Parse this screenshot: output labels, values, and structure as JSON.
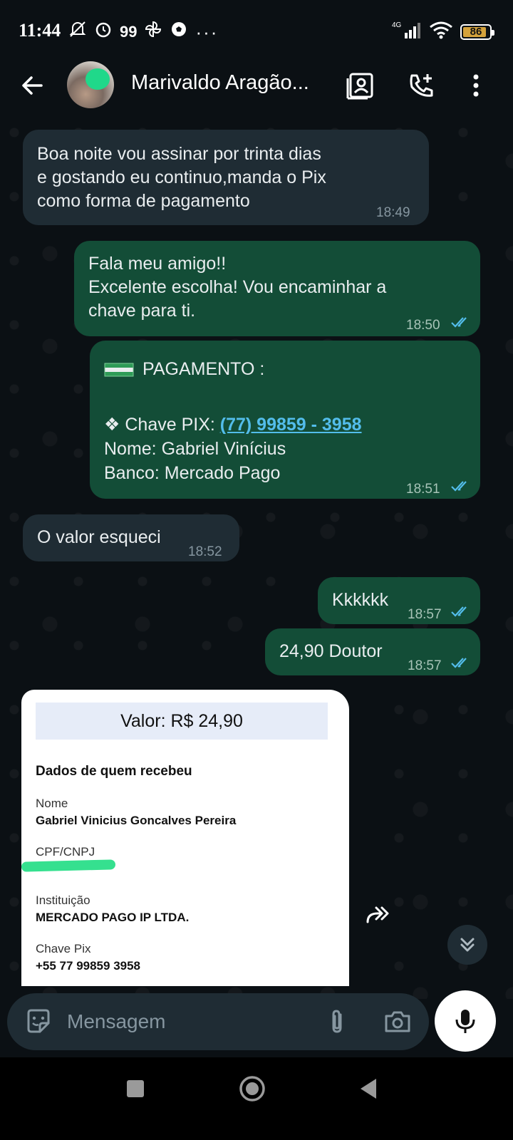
{
  "status": {
    "time": "11:44",
    "left_icons": [
      "mute-icon",
      "alarm-icon",
      "app-99-icon",
      "pinwheel-icon",
      "soccer-icon",
      "more-dots-icon"
    ],
    "app_99": "99",
    "dots": "···",
    "network": "4G",
    "battery": "86"
  },
  "header": {
    "contact_name": "Marivaldo Aragão..."
  },
  "messages": [
    {
      "dir": "in",
      "text": "Boa noite vou assinar por trinta dias\ne gostando eu continuo,manda o Pix\ncomo forma de pagamento",
      "time": "18:49"
    },
    {
      "dir": "out",
      "text": "Fala meu amigo!!\nExcelente escolha! Vou encaminhar a\nchave para ti.",
      "time": "18:50"
    },
    {
      "dir": "out",
      "title": "PAGAMENTO :",
      "pix_label": "❖ Chave PIX: ",
      "pix_value": "(77) 99859 - 3958",
      "nome": "Nome: Gabriel Vinícius",
      "banco": "Banco: Mercado Pago",
      "time": "18:51"
    },
    {
      "dir": "in",
      "text": "O valor esqueci",
      "time": "18:52"
    },
    {
      "dir": "out",
      "text": "Kkkkkk",
      "time": "18:57"
    },
    {
      "dir": "out",
      "text": "24,90 Doutor",
      "time": "18:57"
    }
  ],
  "receipt": {
    "valor": "Valor: R$ 24,90",
    "heading": "Dados de quem recebeu",
    "nome_label": "Nome",
    "nome_value": "Gabriel Vinicius Goncalves Pereira",
    "cpf_label": "CPF/CNPJ",
    "inst_label": "Instituição",
    "inst_value": "MERCADO PAGO IP LTDA.",
    "chave_label": "Chave Pix",
    "chave_value": "+55 77 99859 3958"
  },
  "composer": {
    "placeholder": "Mensagem"
  },
  "colors": {
    "incoming_bubble": "#1f2c34",
    "outgoing_bubble": "#134d37",
    "link": "#53bdeb",
    "read_ticks": "#53bdeb"
  }
}
